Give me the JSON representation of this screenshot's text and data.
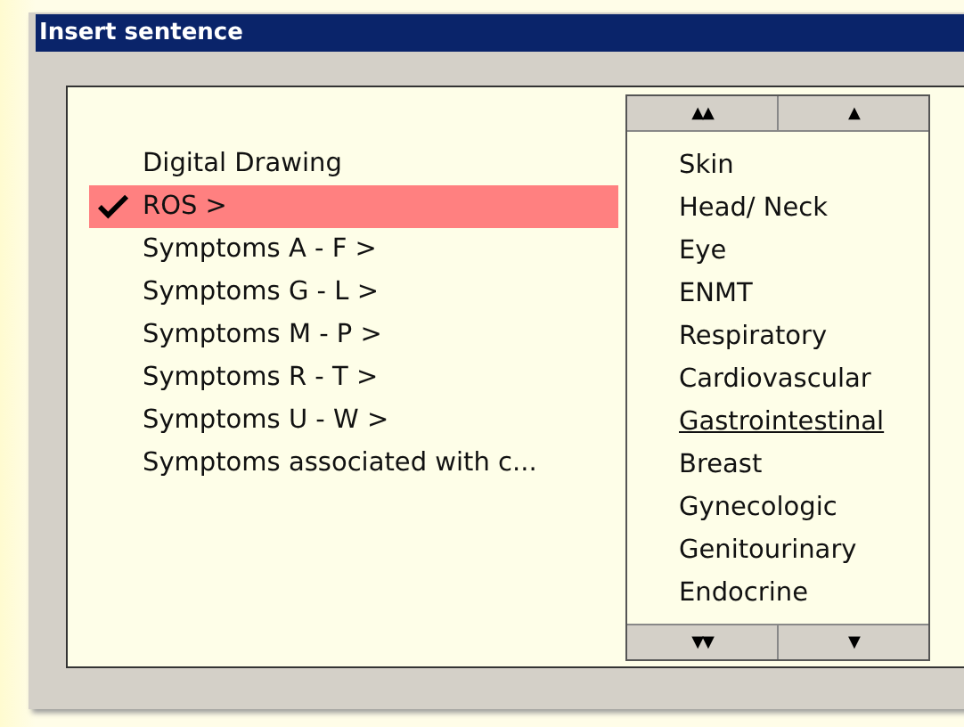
{
  "window": {
    "title": "Insert sentence"
  },
  "menu": {
    "items": [
      {
        "label": "Digital Drawing",
        "selected": false
      },
      {
        "label": "ROS >",
        "selected": true
      },
      {
        "label": "Symptoms A - F >",
        "selected": false
      },
      {
        "label": "Symptoms G - L >",
        "selected": false
      },
      {
        "label": "Symptoms M - P >",
        "selected": false
      },
      {
        "label": "Symptoms R - T >",
        "selected": false
      },
      {
        "label": "Symptoms U - W >",
        "selected": false
      },
      {
        "label": "Symptoms associated with c...",
        "selected": false
      }
    ]
  },
  "submenu": {
    "top_buttons": [
      "▲▲",
      "▲"
    ],
    "items": [
      {
        "label": "Skin",
        "hovered": false
      },
      {
        "label": "Head/ Neck",
        "hovered": false
      },
      {
        "label": "Eye",
        "hovered": false
      },
      {
        "label": "ENMT",
        "hovered": false
      },
      {
        "label": "Respiratory",
        "hovered": false
      },
      {
        "label": "Cardiovascular",
        "hovered": false
      },
      {
        "label": "Gastrointestinal",
        "hovered": true
      },
      {
        "label": "Breast",
        "hovered": false
      },
      {
        "label": "Gynecologic",
        "hovered": false
      },
      {
        "label": "Genitourinary",
        "hovered": false
      },
      {
        "label": "Endocrine",
        "hovered": false
      }
    ],
    "bottom_buttons": [
      "▼▼",
      "▼"
    ]
  }
}
